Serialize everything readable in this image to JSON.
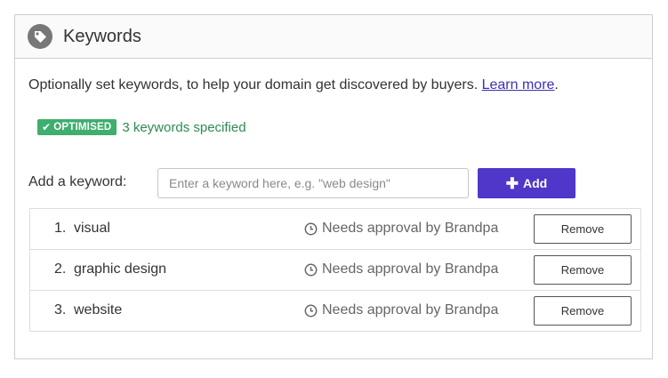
{
  "panel": {
    "title": "Keywords",
    "icon": "tag-icon"
  },
  "intro": {
    "text": "Optionally set keywords, to help your domain get discovered by buyers. ",
    "link": "Learn more",
    "suffix": "."
  },
  "status": {
    "badge": "OPTIMISED",
    "text": "3 keywords specified",
    "badge_color": "#3fae6e",
    "text_color": "#2d8a52"
  },
  "add_keyword": {
    "label": "Add a keyword:",
    "placeholder": "Enter a keyword here, e.g. \"web design\"",
    "value": "",
    "button_label": "Add",
    "button_color": "#5036c9"
  },
  "keywords": [
    {
      "num": "1.",
      "name": "visual",
      "status": "Needs approval by Brandpa",
      "action": "Remove"
    },
    {
      "num": "2.",
      "name": "graphic design",
      "status": "Needs approval by Brandpa",
      "action": "Remove"
    },
    {
      "num": "3.",
      "name": "website",
      "status": "Needs approval by Brandpa",
      "action": "Remove"
    }
  ]
}
